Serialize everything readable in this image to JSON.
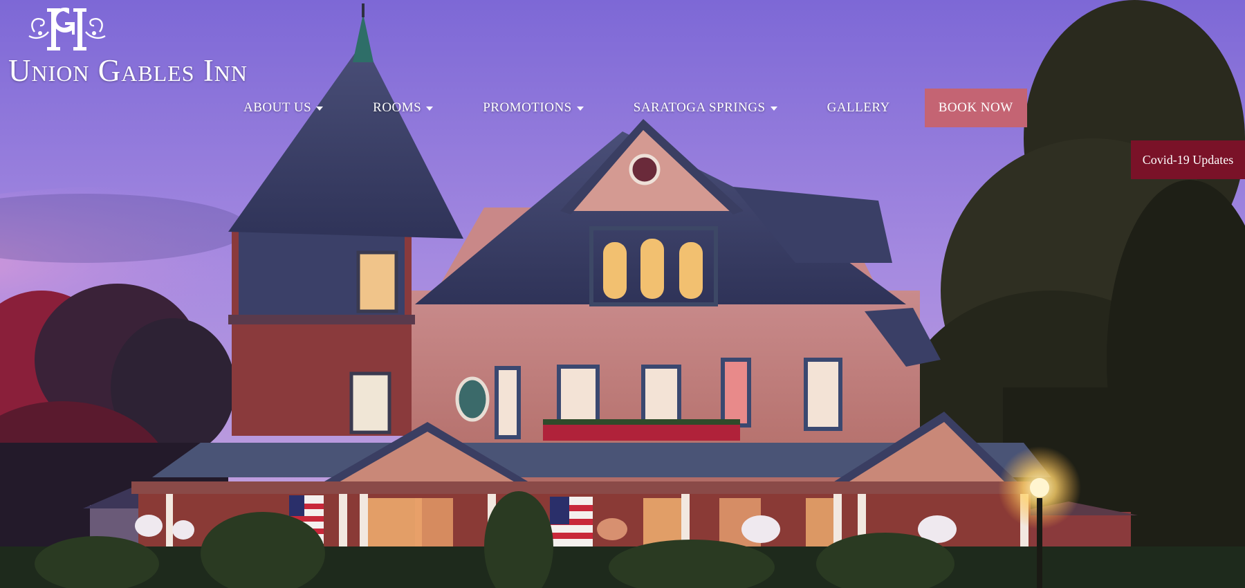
{
  "brand": {
    "monogram": "UGI",
    "name": "Union Gables Inn"
  },
  "nav": {
    "items": [
      {
        "label": "ABOUT US",
        "has_dropdown": true
      },
      {
        "label": "ROOMS",
        "has_dropdown": true
      },
      {
        "label": "PROMOTIONS",
        "has_dropdown": true
      },
      {
        "label": "SARATOGA SPRINGS",
        "has_dropdown": true
      },
      {
        "label": "GALLERY",
        "has_dropdown": false
      }
    ],
    "book_now": "BOOK NOW"
  },
  "covid_tab": "Covid-19 Updates",
  "colors": {
    "book_button": "#c46473",
    "covid_tab": "#7a1228",
    "sky_top": "#8a6fd8",
    "sky_bottom": "#c99ad8"
  },
  "hero": {
    "icon": "victorian-house-photo"
  }
}
